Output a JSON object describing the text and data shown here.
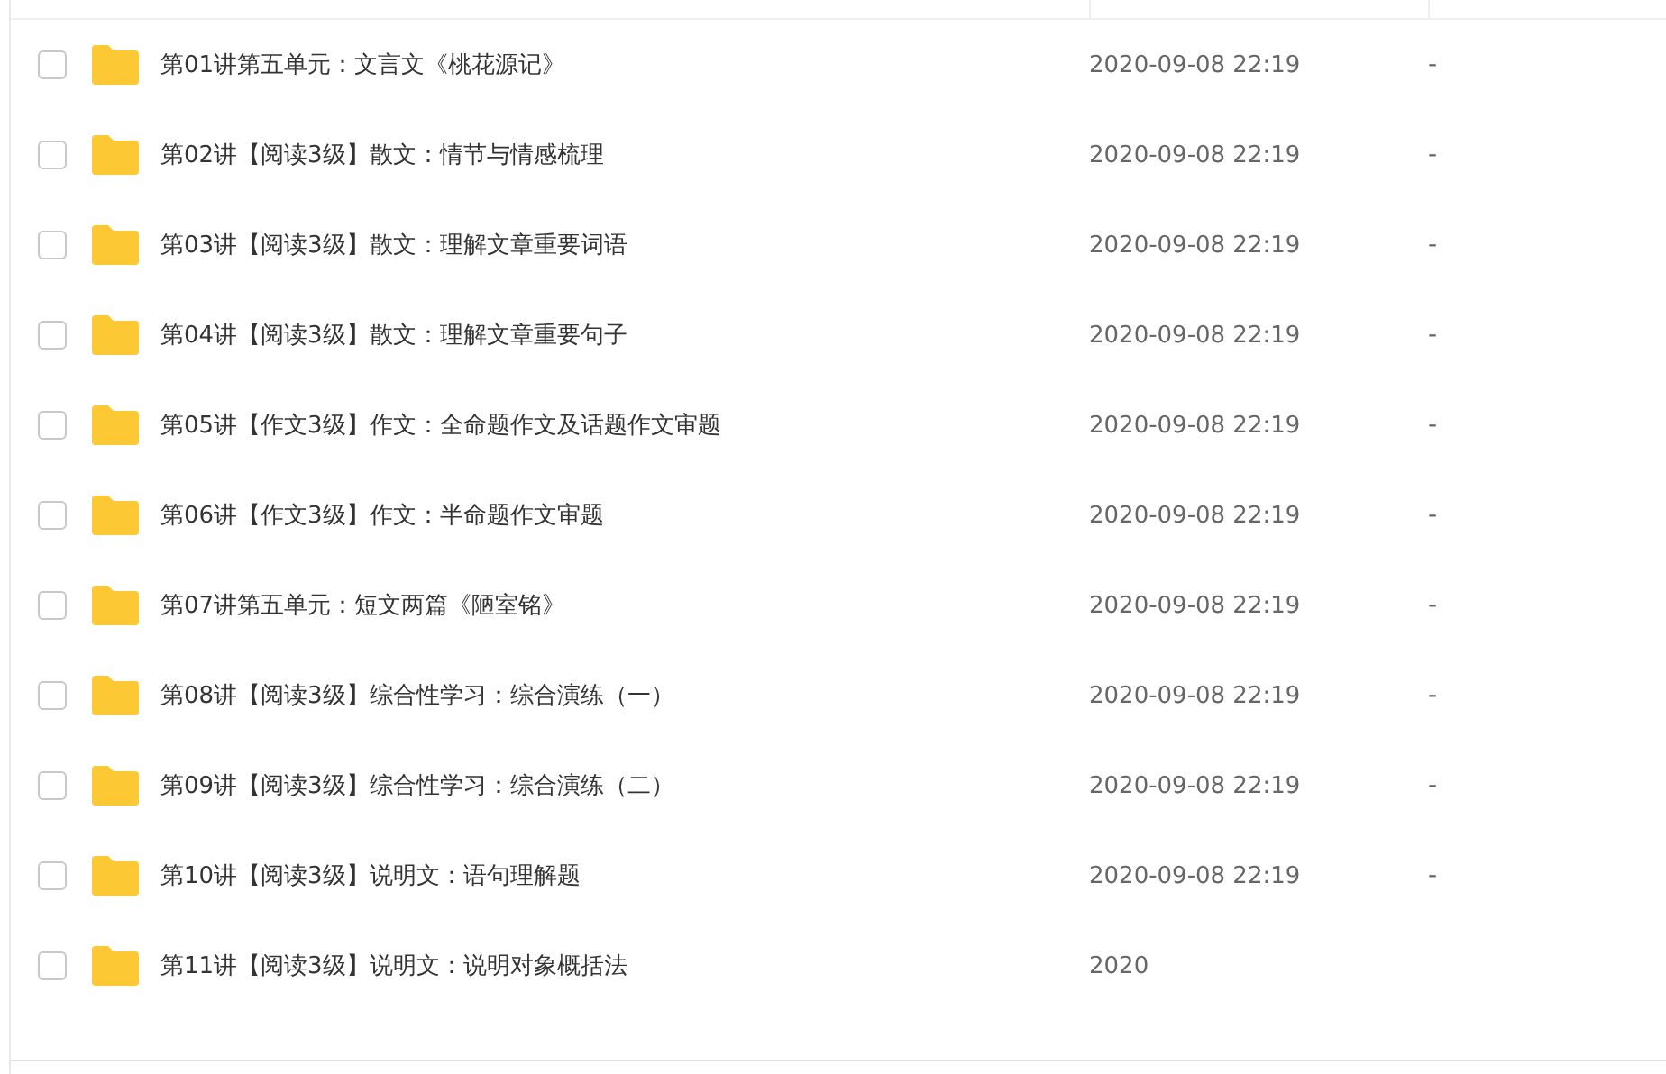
{
  "rows": [
    {
      "name": "第01讲第五单元：文言文《桃花源记》",
      "date": "2020-09-08 22:19",
      "size": "-",
      "checked": false
    },
    {
      "name": "第02讲【阅读3级】散文：情节与情感梳理",
      "date": "2020-09-08 22:19",
      "size": "-",
      "checked": false
    },
    {
      "name": "第03讲【阅读3级】散文：理解文章重要词语",
      "date": "2020-09-08 22:19",
      "size": "-",
      "checked": false
    },
    {
      "name": "第04讲【阅读3级】散文：理解文章重要句子",
      "date": "2020-09-08 22:19",
      "size": "-",
      "checked": false
    },
    {
      "name": "第05讲【作文3级】作文：全命题作文及话题作文审题",
      "date": "2020-09-08 22:19",
      "size": "-",
      "checked": false
    },
    {
      "name": "第06讲【作文3级】作文：半命题作文审题",
      "date": "2020-09-08 22:19",
      "size": "-",
      "checked": false
    },
    {
      "name": "第07讲第五单元：短文两篇《陋室铭》",
      "date": "2020-09-08 22:19",
      "size": "-",
      "checked": false
    },
    {
      "name": "第08讲【阅读3级】综合性学习：综合演练（一）",
      "date": "2020-09-08 22:19",
      "size": "-",
      "checked": false
    },
    {
      "name": "第09讲【阅读3级】综合性学习：综合演练（二）",
      "date": "2020-09-08 22:19",
      "size": "-",
      "checked": false
    },
    {
      "name": "第10讲【阅读3级】说明文：语句理解题",
      "date": "2020-09-08 22:19",
      "size": "-",
      "checked": false
    },
    {
      "name": "第11讲【阅读3级】说明文：说明对象概括法",
      "date": "2020",
      "checked": false
    }
  ]
}
